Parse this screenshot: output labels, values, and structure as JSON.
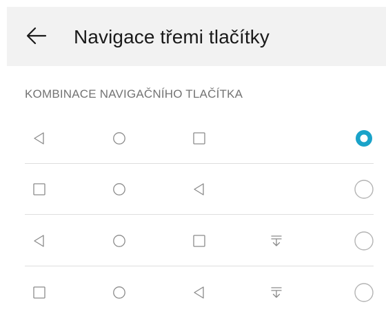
{
  "header": {
    "title": "Navigace třemi tlačítky"
  },
  "section": {
    "label": "KOMBINACE NAVIGAČNÍHO TLAČÍTKA"
  },
  "options": [
    {
      "buttons": [
        "back-icon",
        "home-icon",
        "recents-icon"
      ],
      "selected": true
    },
    {
      "buttons": [
        "recents-icon",
        "home-icon",
        "back-icon"
      ],
      "selected": false
    },
    {
      "buttons": [
        "back-icon",
        "home-icon",
        "recents-icon",
        "notification-drawer-icon"
      ],
      "selected": false
    },
    {
      "buttons": [
        "recents-icon",
        "home-icon",
        "back-icon",
        "notification-drawer-icon"
      ],
      "selected": false
    }
  ],
  "colors": {
    "accent": "#1aa3c9",
    "icon": "#8a8a8a",
    "radio_unselected": "#b3b3b3"
  }
}
